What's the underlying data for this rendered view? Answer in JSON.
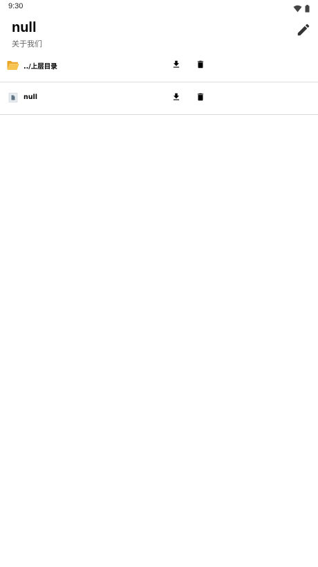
{
  "status_bar": {
    "time": "9:30",
    "icons": [
      "wifi-icon",
      "battery-icon"
    ]
  },
  "header": {
    "title": "null",
    "subtitle": "关于我们",
    "action_icon": "edit-icon"
  },
  "files": [
    {
      "label": "../上层目录",
      "icon": "folder-open-icon",
      "actions": [
        "download-icon",
        "delete-icon"
      ]
    },
    {
      "label": "null",
      "icon": "file-icon",
      "actions": [
        "download-icon",
        "delete-icon"
      ]
    }
  ],
  "colors": {
    "folder": "#F5B63A",
    "file": "#5F7383",
    "divider": "#DCDCDC",
    "subtitle": "#666666"
  }
}
